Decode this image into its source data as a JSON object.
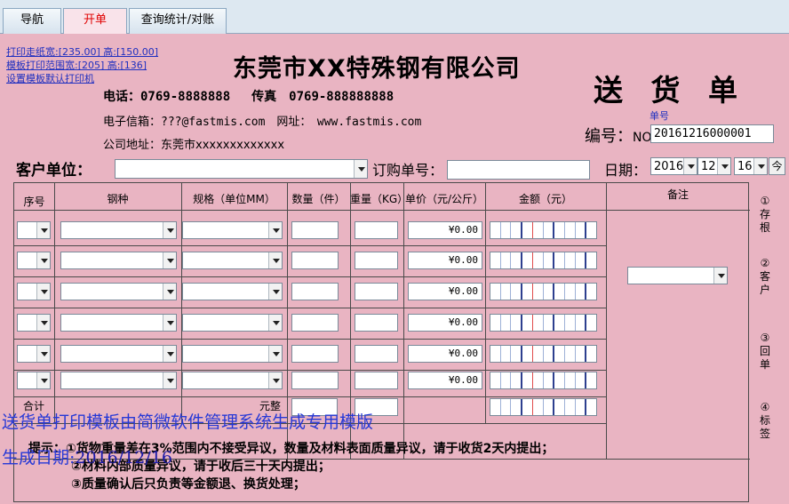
{
  "tabs": [
    {
      "label": "导航"
    },
    {
      "label": "开单"
    },
    {
      "label": "查询统计/对账"
    }
  ],
  "links": [
    "打印走纸宽:[235.00] 高:[150.00]",
    "模板打印范围宽:[205] 高:[136]",
    "设置模板默认打印机"
  ],
  "company": {
    "name": "东莞市XX特殊钢有限公司",
    "phone_label": "电话：0769-8888888",
    "fax_label": "传真　0769-888888888",
    "email_label": "电子信箱：???@fastmis.com　网址：　www.fastmis.com",
    "address_label": "公司地址：东莞市xxxxxxxxxxxxx"
  },
  "doc": {
    "title": "送 货 单",
    "no_hint": "单号",
    "no_label": "编号：",
    "no_prefix": "NO",
    "no_value": "20161216000001"
  },
  "form": {
    "customer_label": "客户单位：",
    "customer_value": "",
    "order_label": "订购单号：",
    "order_value": "",
    "date_label": "日期：",
    "year": "2016",
    "month": "12",
    "day": "16",
    "today_btn": "今"
  },
  "table": {
    "headers": [
      "序号",
      "钢种",
      "规格（单位MM）",
      "数量（件）",
      "重量（KG）",
      "单价（元/公斤）",
      "金额（元）",
      "备注"
    ],
    "rows": [
      {
        "price": "¥0.00"
      },
      {
        "price": "¥0.00"
      },
      {
        "price": "¥0.00"
      },
      {
        "price": "¥0.00"
      },
      {
        "price": "¥0.00"
      },
      {
        "price": "¥0.00"
      }
    ],
    "total_label": "合计",
    "yuan_label": "元整"
  },
  "side_stamps": [
    {
      "num": "①",
      "text": "存根"
    },
    {
      "num": "②",
      "text": "客户"
    },
    {
      "num": "③",
      "text": "回单"
    },
    {
      "num": "④",
      "text": "标签"
    }
  ],
  "notes": {
    "prefix": "提示：",
    "line1": "①货物重量差在3%范围内不接受异议，数量及材料表面质量异议，请于收货2天内提出；",
    "line2": "②材料内部质量异议，请于收后三十天内提出；",
    "line3": "③质量确认后只负责等金额退、换货处理；"
  },
  "overlay": {
    "line1": "送货单打印模板由简微软件管理系统生成专用模版",
    "gen_label": "生成日期:",
    "gen_date": "2016/12/16"
  }
}
